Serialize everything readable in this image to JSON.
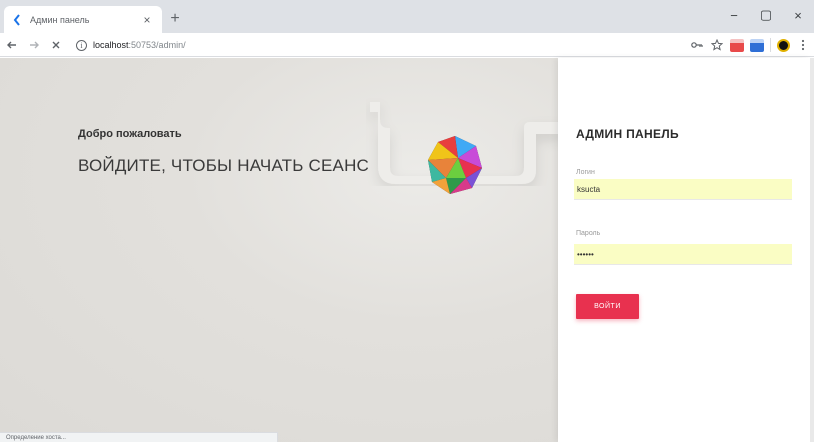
{
  "browser": {
    "tab_title": "Админ панель",
    "tab_close": "×",
    "new_tab": "+",
    "url_host": "localhost",
    "url_rest": ":50753/admin/",
    "window_controls": {
      "minimize": "−",
      "maximize": "▢",
      "close": "×"
    },
    "status_text": "Определение хоста..."
  },
  "hero": {
    "welcome": "Добро пожаловать",
    "headline": "ВОЙДИТЕ, ЧТОБЫ НАЧАТЬ СЕАНС"
  },
  "login": {
    "title": "АДМИН ПАНЕЛЬ",
    "login_label": "Логин",
    "login_value": "ksucta",
    "password_label": "Пароль",
    "password_value": "••••••",
    "submit_label": "ВОЙТИ"
  },
  "colors": {
    "accent": "#e8314f",
    "autofill": "#fafdc4",
    "left_bg": "#e3e1dd"
  },
  "icons": [
    "back-arrow-icon",
    "forward-arrow-icon",
    "reload-stop-icon",
    "info-icon",
    "key-icon",
    "star-icon",
    "extension-icon",
    "profile-icon",
    "menu-icon"
  ]
}
